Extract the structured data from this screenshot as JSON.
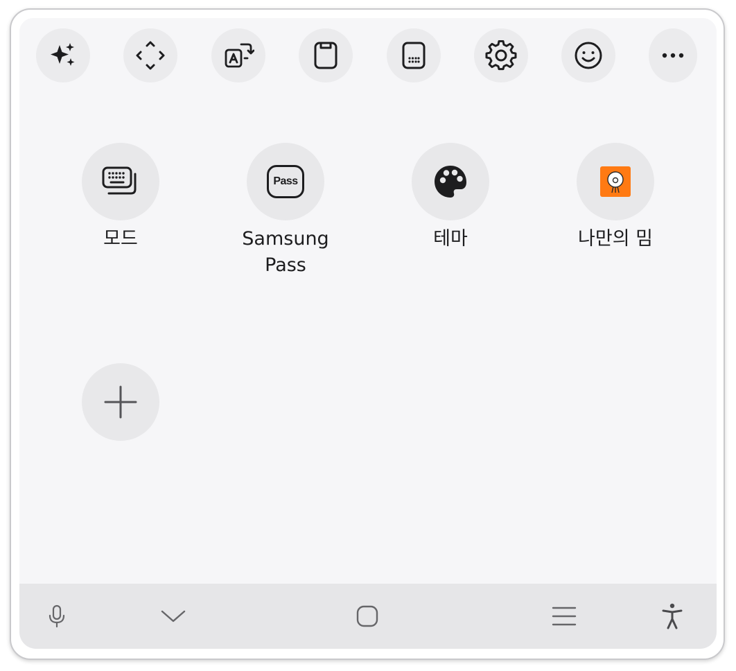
{
  "toolbar": {
    "items": [
      {
        "icon": "sparkle-icon"
      },
      {
        "icon": "arrows-move-icon"
      },
      {
        "icon": "translate-icon"
      },
      {
        "icon": "clipboard-icon"
      },
      {
        "icon": "keyboard-size-icon"
      },
      {
        "icon": "gear-icon"
      },
      {
        "icon": "emoji-icon"
      },
      {
        "icon": "more-icon"
      }
    ]
  },
  "grid": {
    "items": [
      {
        "label": "모드",
        "icon": "keyboard-mode-icon"
      },
      {
        "label": "Samsung\nPass",
        "icon_text": "Pass",
        "icon": "samsung-pass-icon"
      },
      {
        "label": "테마",
        "icon": "palette-icon"
      },
      {
        "label": "나만의 밈",
        "icon": "my-meme-icon",
        "icon_bg": "#ff7a13"
      }
    ],
    "add": {
      "icon": "plus-icon"
    }
  },
  "nav": {
    "items": [
      {
        "icon": "microphone-icon"
      },
      {
        "icon": "chevron-down-icon"
      },
      {
        "icon": "home-icon"
      },
      {
        "icon": "recents-icon"
      },
      {
        "icon": "accessibility-icon"
      }
    ]
  },
  "colors": {
    "panel_bg": "#f6f6f8",
    "button_bg": "#ebebed",
    "icon": "#1d1d1f",
    "nav_bg": "#e6e6e8",
    "meme_orange": "#ff7a13"
  }
}
